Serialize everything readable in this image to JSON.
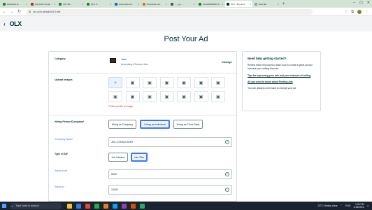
{
  "browser": {
    "tabs": [
      {
        "label": "Dartboard H...",
        "color": "#2e7d32",
        "active": false
      },
      {
        "label": "(31) Dark Cloud...",
        "color": "#c62828",
        "active": false
      },
      {
        "label": "(61) Stil...",
        "color": "#2e7d32",
        "active": false
      },
      {
        "label": "(8) 1.5...",
        "color": "#2e7d32",
        "active": false
      },
      {
        "label": "download anti...",
        "color": "#1565c0",
        "active": false
      },
      {
        "label": "Download bat...",
        "color": "#ef6c00",
        "active": false
      },
      {
        "label": "... برای ...",
        "color": "#555555",
        "active": false
      },
      {
        "label": "CLEARSRIDES L...",
        "color": "#2e7d32",
        "active": false
      },
      {
        "label": "OLX - Buy and...",
        "color": "#002f34",
        "active": true
      },
      {
        "label": "New tab",
        "color": "#9e9e9e",
        "active": false
      }
    ],
    "newtab": "+",
    "win_controls": [
      "–",
      "▢",
      "✕"
    ],
    "url": "olx.com.pk/ad/ccf3-9.ddt",
    "nav": {
      "back": "←",
      "forward": "→",
      "reload": "↻"
    }
  },
  "site": {
    "back": "‹",
    "logo": "OLX"
  },
  "page": {
    "title": "Post Your Ad"
  },
  "form": {
    "category": {
      "label": "Category",
      "name": "Jobs",
      "sub": "Accounting & Finance Jobs",
      "change": "Change"
    },
    "upload": {
      "label": "Upload Images",
      "add_icon": "+",
      "tile_icon": "▣",
      "tile_count": 14,
      "error": "Please provide an image"
    },
    "hiring": {
      "label": "Hiring Person/Company*",
      "options": [
        {
          "label": "Hiring as Company",
          "selected": false
        },
        {
          "label": "Hiring as Individual",
          "selected": true
        },
        {
          "label": "Hiring as Third Party",
          "selected": false
        }
      ]
    },
    "company_name": {
      "label": "Company Name",
      "value": "JML CONSULTANT"
    },
    "type_of_ad": {
      "label": "Type of Ad*",
      "options": [
        {
          "label": "Job Wanted",
          "selected": false
        },
        {
          "label": "Job Offer",
          "selected": true
        }
      ]
    },
    "salary_from": {
      "label": "Salary from",
      "value": "5000"
    },
    "salary_to": {
      "label": "Salary to",
      "value": "10000"
    },
    "ok_icon": "✓"
  },
  "help": {
    "title": "Need help getting started?",
    "intro": "Review these resources to learn how to create a great ad and increase your selling chances",
    "link1": "Tips for improving your ads and your chances of selling",
    "link2": "All you need to know about Posting Ads",
    "outro": "You can always come back to change your ad"
  },
  "taskbar": {
    "search_placeholder": "Type here to search",
    "weather": "23°C  Mostly clear",
    "lang": "ENG",
    "time": "1:06 PM",
    "date": "1/16/2024",
    "apps": [
      "#f4c430",
      "#3a7bd5",
      "#e0483e",
      "#2aa84a",
      "#e67e22",
      "#0aa1ed",
      "#8e44ad",
      "#d35400",
      "#27ae60"
    ]
  }
}
